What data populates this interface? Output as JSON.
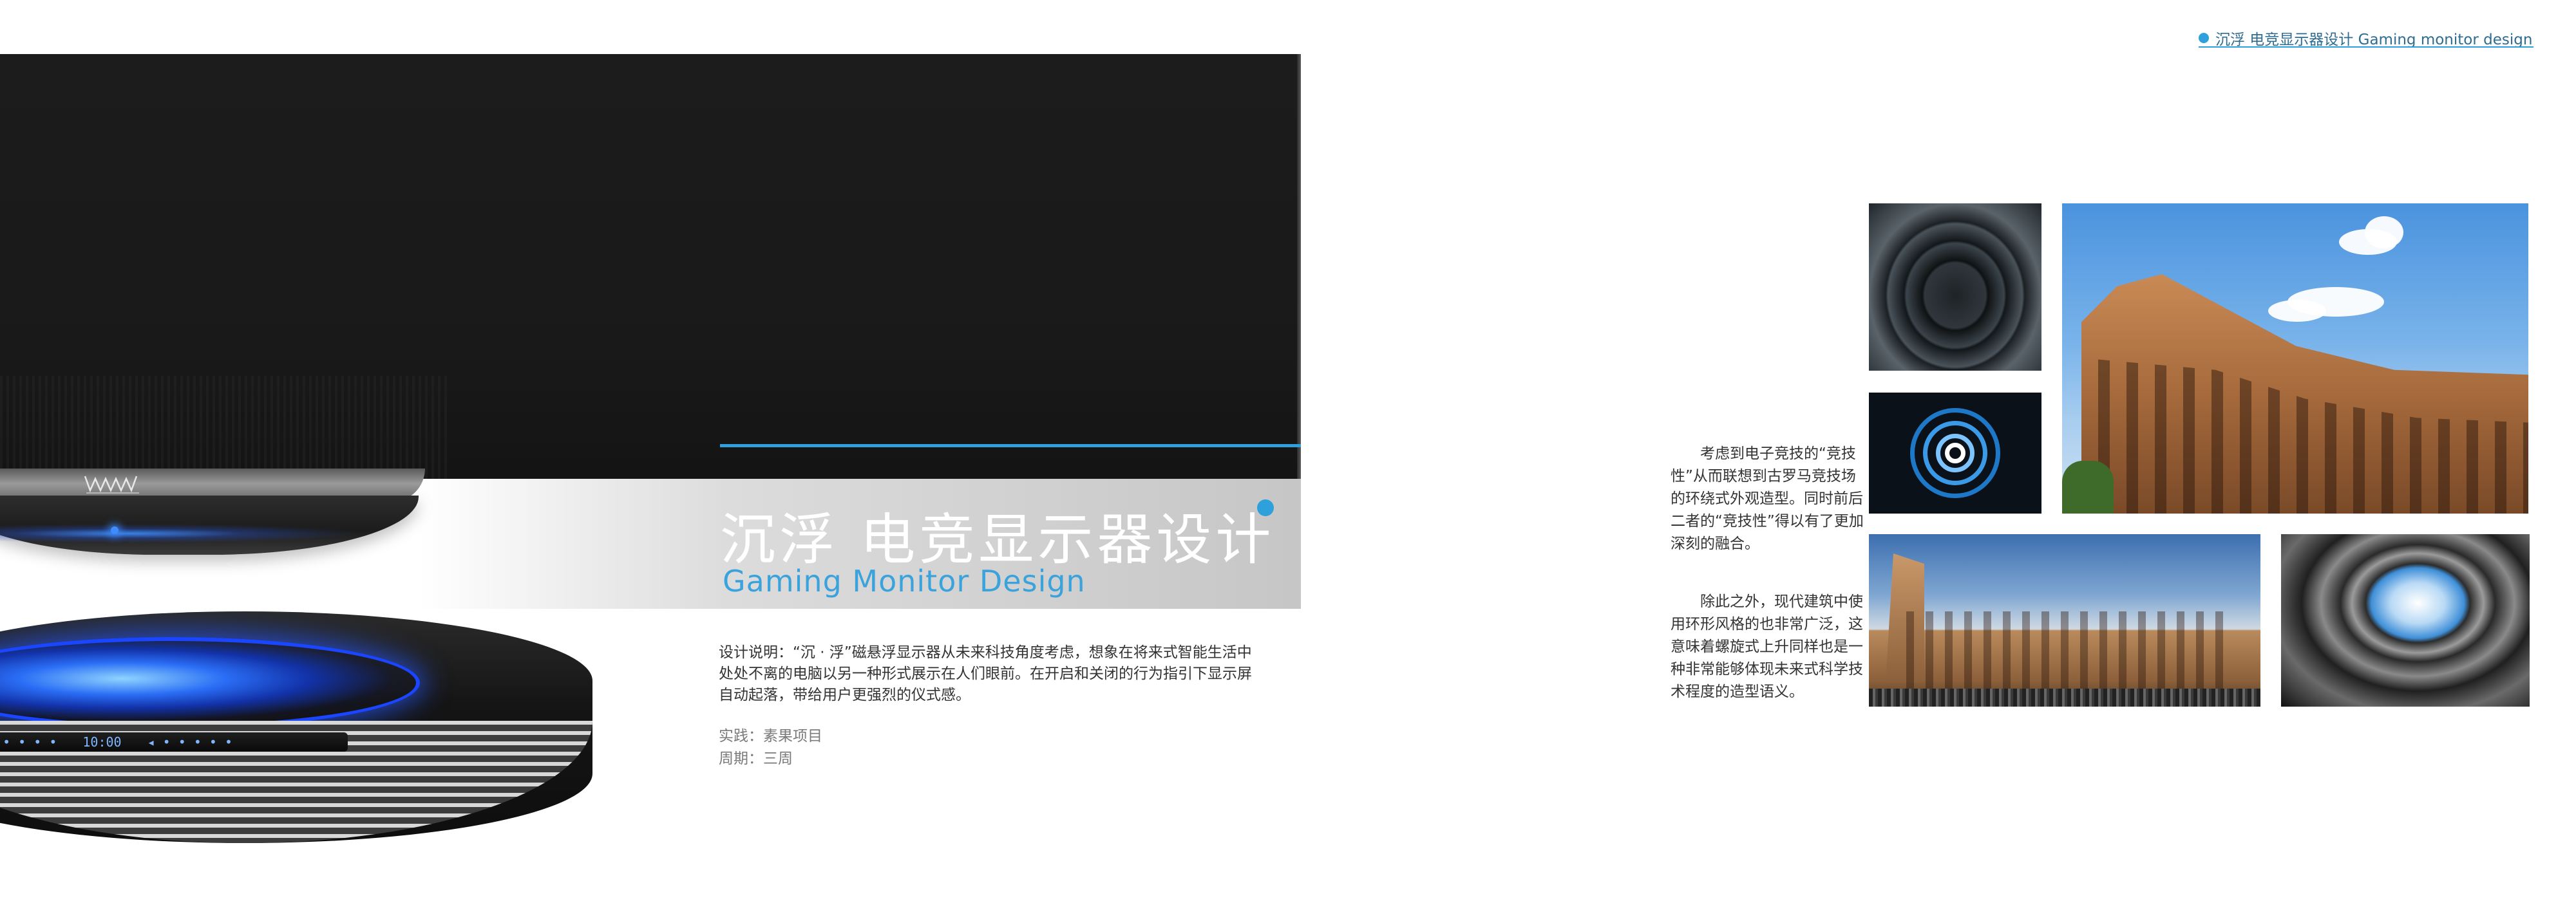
{
  "header": {
    "tag": "沉浮 电竞显示器设计 Gaming monitor design"
  },
  "hero": {
    "title_cn": "沉浮 电竞显示器设计",
    "title_en": "Gaming Monitor Design",
    "brand_logo": "MMWY",
    "base_display_time": "10:00"
  },
  "description": {
    "text": "设计说明：“沉 · 浮”磁悬浮显示器从未来科技角度考虑，想象在将来式智能生活中处处不离的电脑以另一种形式展示在人们眼前。在开启和关闭的行为指引下显示屏自动起落，带给用户更强烈的仪式感。",
    "practice": "实践：素果项目",
    "period": "周期：三周"
  },
  "right_text": {
    "para1": "考虑到电子竞技的“竞技性”从而联想到古罗马竞技场的环绕式外观造型。同时前后二者的“竞技性”得以有了更加深刻的融合。",
    "para2": "除此之外，现代建筑中使用环形风格的也非常广泛，这意味着螺旋式上升同样也是一种非常能够体现未来式科学技术程度的造型语义。"
  },
  "colors": {
    "accent": "#2ea0dc",
    "screen": "#1a1a1a",
    "title_en": "#3aa3dc"
  },
  "icons": {
    "title_dot": "blue-dot-icon",
    "header_dot": "header-dot-icon"
  }
}
